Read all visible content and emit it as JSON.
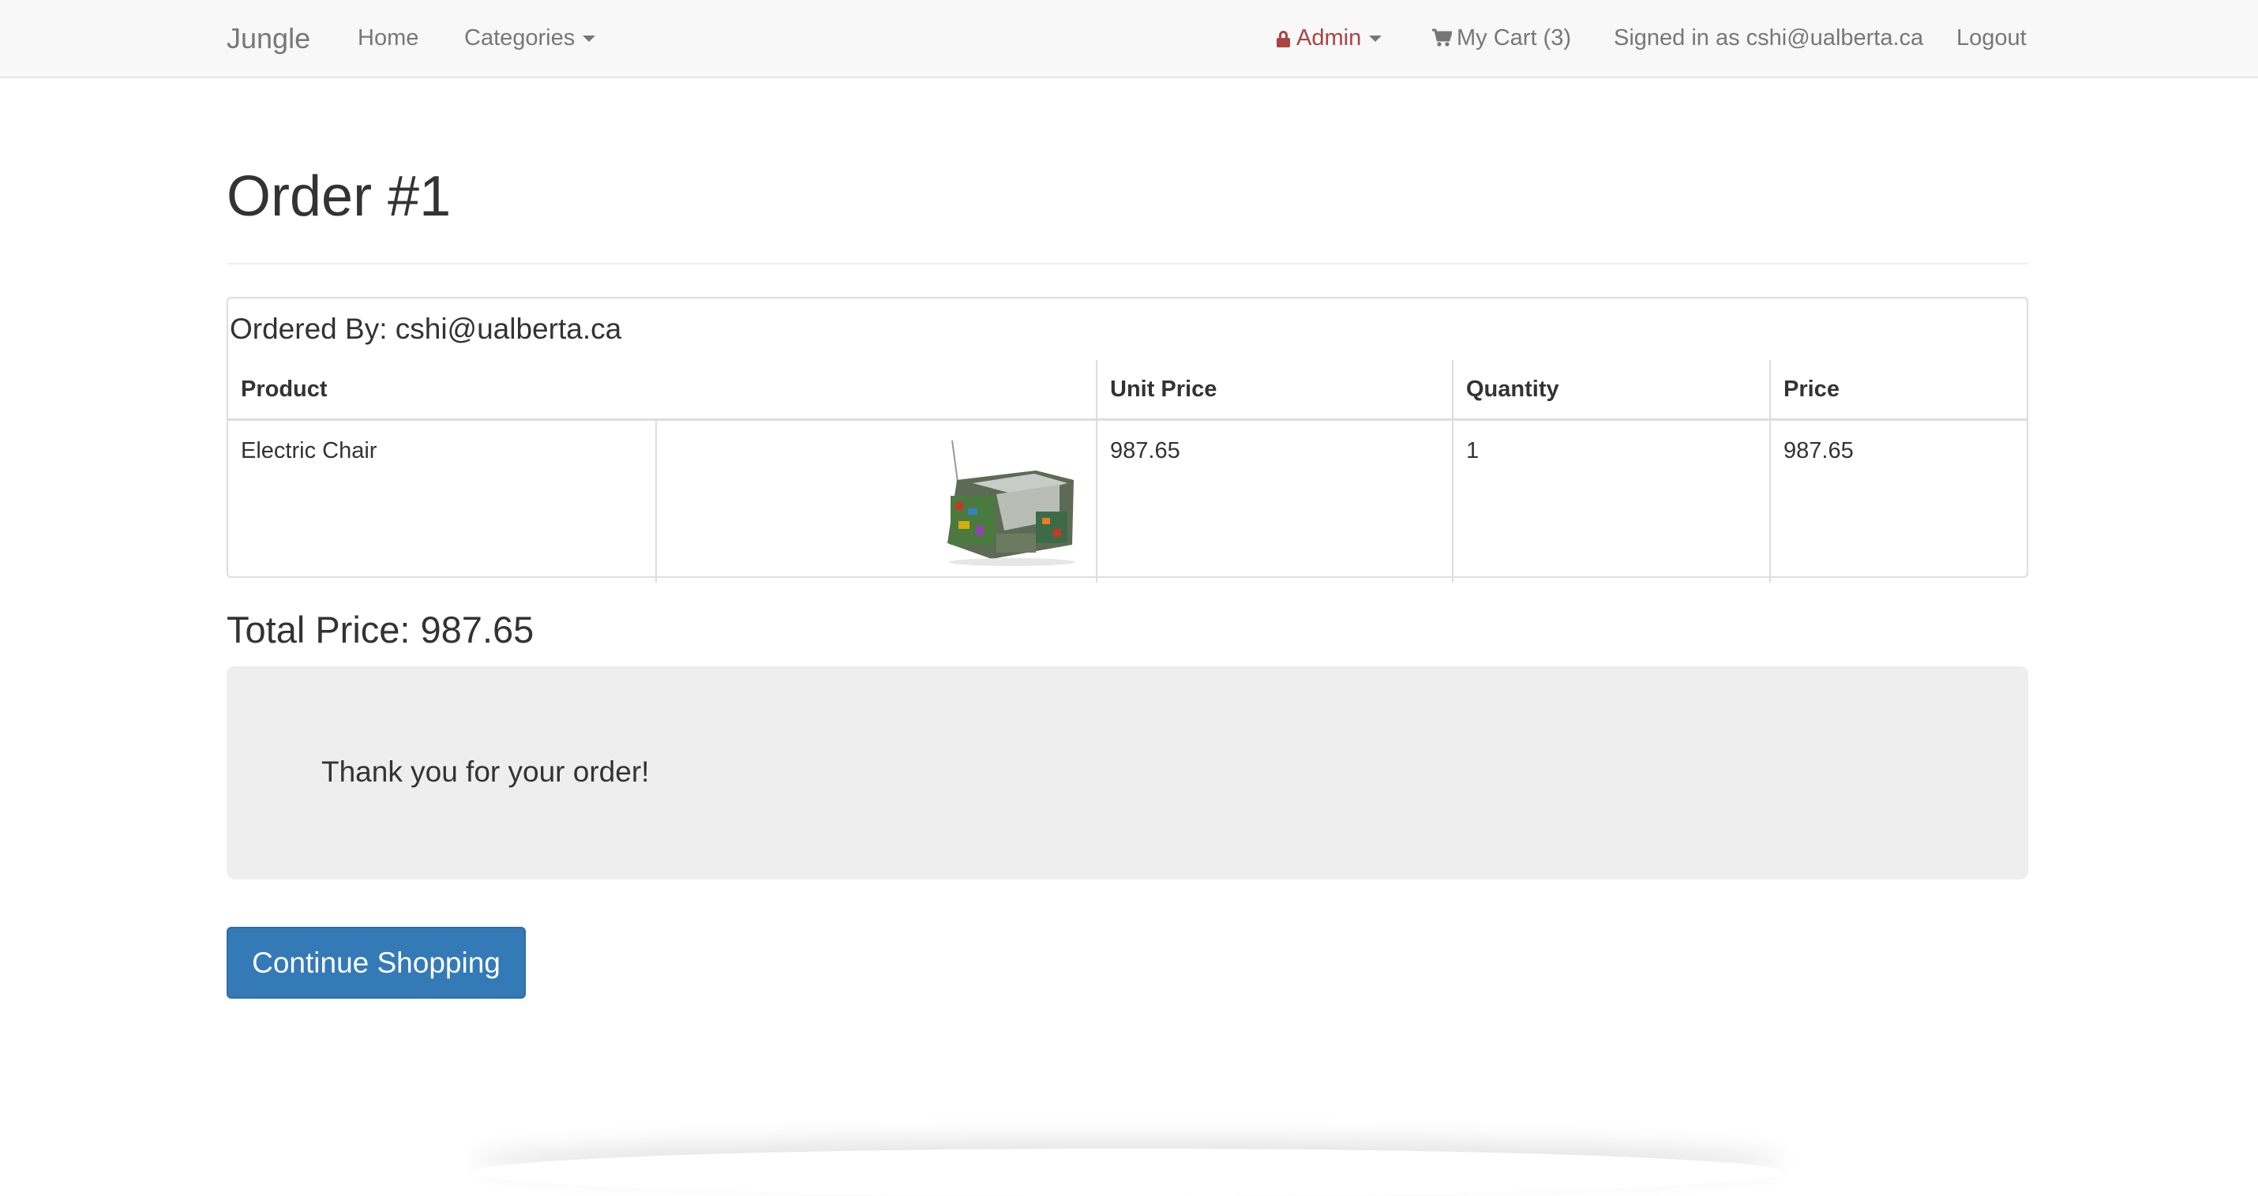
{
  "navbar": {
    "brand": "Jungle",
    "home": "Home",
    "categories": "Categories",
    "admin": "Admin",
    "cart": "My Cart (3)",
    "signed_in": "Signed in as cshi@ualberta.ca",
    "logout": "Logout",
    "admin_color": "#a94442"
  },
  "order": {
    "title": "Order #1",
    "ordered_by": "Ordered By: cshi@ualberta.ca",
    "columns": {
      "product": "Product",
      "unit_price": "Unit Price",
      "quantity": "Quantity",
      "price": "Price"
    },
    "items": [
      {
        "name": "Electric Chair",
        "image": "chair-thumbnail",
        "unit_price": "987.65",
        "quantity": "1",
        "price": "987.65"
      }
    ],
    "total": "Total Price: 987.65"
  },
  "thanks_message": "Thank you for your order!",
  "continue_button": "Continue Shopping",
  "primary_color": "#337ab7"
}
